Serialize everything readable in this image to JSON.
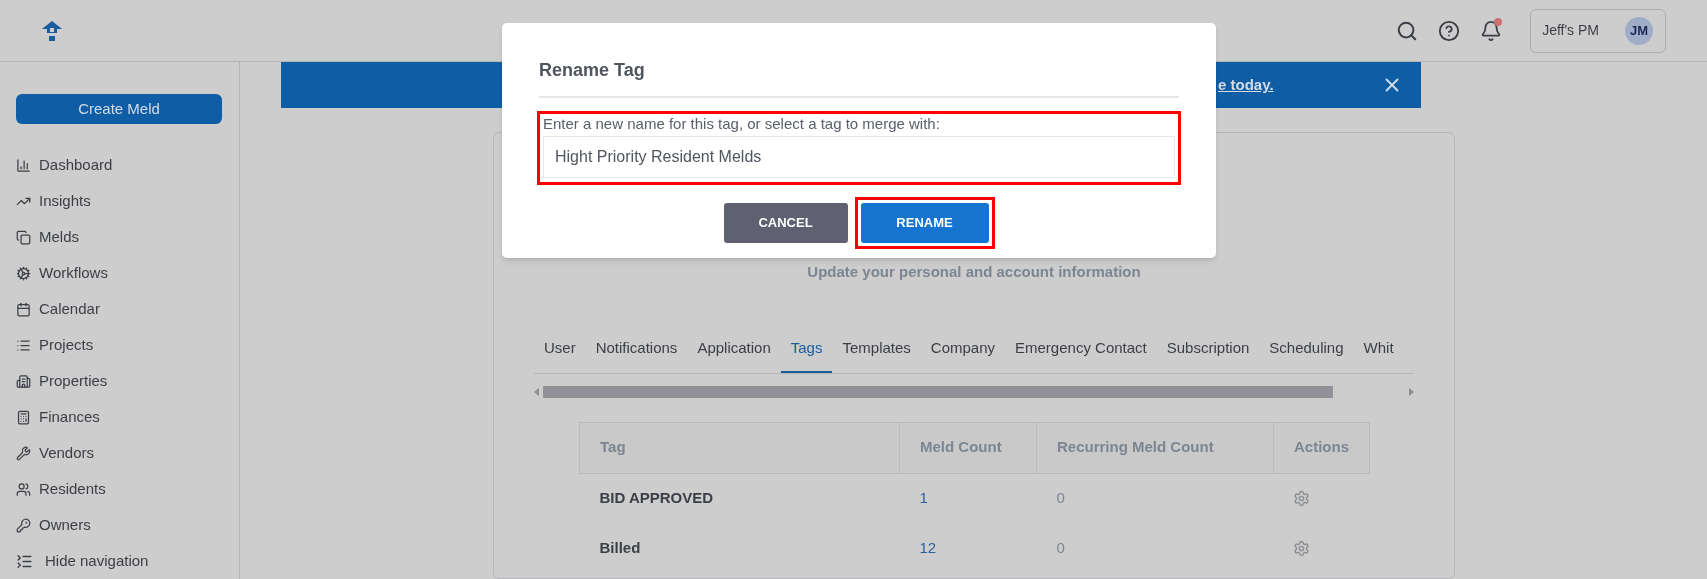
{
  "header": {
    "account": {
      "name": "Jeff's PM",
      "initials": "JM"
    },
    "notifications_unread": true
  },
  "sidebar": {
    "create_button": "Create Meld",
    "items": [
      {
        "label": "Dashboard"
      },
      {
        "label": "Insights"
      },
      {
        "label": "Melds"
      },
      {
        "label": "Workflows"
      },
      {
        "label": "Calendar"
      },
      {
        "label": "Projects"
      },
      {
        "label": "Properties"
      },
      {
        "label": "Finances"
      },
      {
        "label": "Vendors"
      },
      {
        "label": "Residents"
      },
      {
        "label": "Owners"
      }
    ],
    "hide_navigation": "Hide navigation"
  },
  "banner": {
    "link": "e today."
  },
  "settings": {
    "subtitle": "Update your personal and account information",
    "tabs": [
      {
        "label": "User",
        "selected": false
      },
      {
        "label": "Notifications",
        "selected": false
      },
      {
        "label": "Application",
        "selected": false
      },
      {
        "label": "Tags",
        "selected": true
      },
      {
        "label": "Templates",
        "selected": false
      },
      {
        "label": "Company",
        "selected": false
      },
      {
        "label": "Emergency Contact",
        "selected": false
      },
      {
        "label": "Subscription",
        "selected": false
      },
      {
        "label": "Scheduling",
        "selected": false
      },
      {
        "label": "Whit",
        "selected": false
      }
    ],
    "table": {
      "columns": [
        "Tag",
        "Meld Count",
        "Recurring Meld Count",
        "Actions"
      ],
      "rows": [
        {
          "tag": "BID APPROVED",
          "meld_count": "1",
          "recurring_meld_count": "0"
        },
        {
          "tag": "Billed",
          "meld_count": "12",
          "recurring_meld_count": "0"
        }
      ]
    }
  },
  "dialog": {
    "title": "Rename Tag",
    "label": "Enter a new name for this tag, or select a tag to merge with:",
    "value": "Hight Priority Resident Melds",
    "buttons": [
      {
        "label": "CANCEL",
        "kind": "secondary"
      },
      {
        "label": "RENAME",
        "kind": "primary"
      }
    ]
  }
}
